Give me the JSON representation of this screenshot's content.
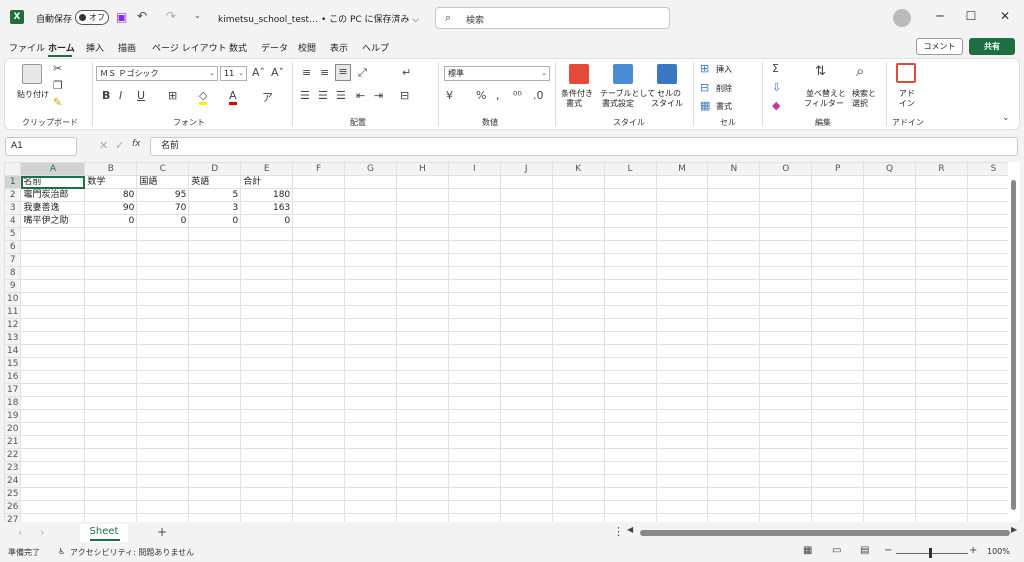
{
  "titlebar": {
    "app_icon": "X",
    "autosave_label": "自動保存",
    "autosave_state": "オフ",
    "filename": "kimetsu_school_test… • この PC に保存済み ⌵",
    "search_placeholder": "検索",
    "minimize": "─",
    "maximize": "☐",
    "close": "✕"
  },
  "menu": {
    "tabs": [
      "ファイル",
      "ホーム",
      "挿入",
      "描画",
      "ページ レイアウト",
      "数式",
      "データ",
      "校閲",
      "表示",
      "ヘルプ"
    ],
    "comment_label": "コメント",
    "share_label": "共有"
  },
  "ribbon": {
    "clipboard": {
      "paste": "貼り付け",
      "label": "クリップボード"
    },
    "font": {
      "name": "ＭＳ Ｐゴシック",
      "size": "11",
      "label": "フォント"
    },
    "alignment": {
      "label": "配置"
    },
    "number": {
      "format": "標準",
      "label": "数値"
    },
    "style": {
      "conditional": [
        "条件付き",
        "書式"
      ],
      "table": [
        "テーブルとして",
        "書式設定"
      ],
      "cell_style": [
        "セルの",
        "スタイル"
      ],
      "label": "スタイル"
    },
    "cells": {
      "insert": "挿入",
      "delete": "削除",
      "format": "書式",
      "label": "セル"
    },
    "editing": {
      "sort": [
        "並べ替えと",
        "フィルター"
      ],
      "find": [
        "検索と",
        "選択"
      ],
      "label": "編集"
    },
    "addin": {
      "btn": [
        "アド",
        "イン"
      ],
      "label": "アドイン"
    }
  },
  "formula_bar": {
    "name_box": "A1",
    "fx": "fx",
    "content": "名前"
  },
  "sheet": {
    "columns": [
      "A",
      "B",
      "C",
      "D",
      "E",
      "F",
      "G",
      "H",
      "I",
      "J",
      "K",
      "L",
      "M",
      "N",
      "O",
      "P",
      "Q",
      "R",
      "S"
    ],
    "row_count": 27,
    "header": [
      "名前",
      "数学",
      "国語",
      "英語",
      "合計"
    ],
    "rows": [
      [
        "竈門炭治郎",
        "80",
        "95",
        "5",
        "180"
      ],
      [
        "我妻善逸",
        "90",
        "70",
        "3",
        "163"
      ],
      [
        "嘴平伊之助",
        "0",
        "0",
        "0",
        "0"
      ]
    ]
  },
  "tabs": {
    "sheet_name": "Sheet",
    "add": "+"
  },
  "status": {
    "ready": "準備完了",
    "accessibility": "アクセシビリティ: 問題ありません",
    "zoom": "100%"
  }
}
